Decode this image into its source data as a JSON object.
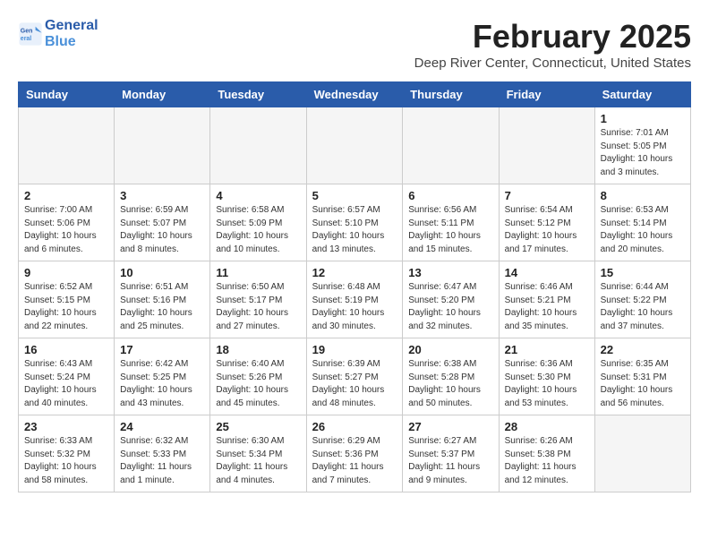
{
  "header": {
    "logo_line1": "General",
    "logo_line2": "Blue",
    "month_year": "February 2025",
    "location": "Deep River Center, Connecticut, United States"
  },
  "weekdays": [
    "Sunday",
    "Monday",
    "Tuesday",
    "Wednesday",
    "Thursday",
    "Friday",
    "Saturday"
  ],
  "weeks": [
    [
      {
        "day": "",
        "info": ""
      },
      {
        "day": "",
        "info": ""
      },
      {
        "day": "",
        "info": ""
      },
      {
        "day": "",
        "info": ""
      },
      {
        "day": "",
        "info": ""
      },
      {
        "day": "",
        "info": ""
      },
      {
        "day": "1",
        "info": "Sunrise: 7:01 AM\nSunset: 5:05 PM\nDaylight: 10 hours and 3 minutes."
      }
    ],
    [
      {
        "day": "2",
        "info": "Sunrise: 7:00 AM\nSunset: 5:06 PM\nDaylight: 10 hours and 6 minutes."
      },
      {
        "day": "3",
        "info": "Sunrise: 6:59 AM\nSunset: 5:07 PM\nDaylight: 10 hours and 8 minutes."
      },
      {
        "day": "4",
        "info": "Sunrise: 6:58 AM\nSunset: 5:09 PM\nDaylight: 10 hours and 10 minutes."
      },
      {
        "day": "5",
        "info": "Sunrise: 6:57 AM\nSunset: 5:10 PM\nDaylight: 10 hours and 13 minutes."
      },
      {
        "day": "6",
        "info": "Sunrise: 6:56 AM\nSunset: 5:11 PM\nDaylight: 10 hours and 15 minutes."
      },
      {
        "day": "7",
        "info": "Sunrise: 6:54 AM\nSunset: 5:12 PM\nDaylight: 10 hours and 17 minutes."
      },
      {
        "day": "8",
        "info": "Sunrise: 6:53 AM\nSunset: 5:14 PM\nDaylight: 10 hours and 20 minutes."
      }
    ],
    [
      {
        "day": "9",
        "info": "Sunrise: 6:52 AM\nSunset: 5:15 PM\nDaylight: 10 hours and 22 minutes."
      },
      {
        "day": "10",
        "info": "Sunrise: 6:51 AM\nSunset: 5:16 PM\nDaylight: 10 hours and 25 minutes."
      },
      {
        "day": "11",
        "info": "Sunrise: 6:50 AM\nSunset: 5:17 PM\nDaylight: 10 hours and 27 minutes."
      },
      {
        "day": "12",
        "info": "Sunrise: 6:48 AM\nSunset: 5:19 PM\nDaylight: 10 hours and 30 minutes."
      },
      {
        "day": "13",
        "info": "Sunrise: 6:47 AM\nSunset: 5:20 PM\nDaylight: 10 hours and 32 minutes."
      },
      {
        "day": "14",
        "info": "Sunrise: 6:46 AM\nSunset: 5:21 PM\nDaylight: 10 hours and 35 minutes."
      },
      {
        "day": "15",
        "info": "Sunrise: 6:44 AM\nSunset: 5:22 PM\nDaylight: 10 hours and 37 minutes."
      }
    ],
    [
      {
        "day": "16",
        "info": "Sunrise: 6:43 AM\nSunset: 5:24 PM\nDaylight: 10 hours and 40 minutes."
      },
      {
        "day": "17",
        "info": "Sunrise: 6:42 AM\nSunset: 5:25 PM\nDaylight: 10 hours and 43 minutes."
      },
      {
        "day": "18",
        "info": "Sunrise: 6:40 AM\nSunset: 5:26 PM\nDaylight: 10 hours and 45 minutes."
      },
      {
        "day": "19",
        "info": "Sunrise: 6:39 AM\nSunset: 5:27 PM\nDaylight: 10 hours and 48 minutes."
      },
      {
        "day": "20",
        "info": "Sunrise: 6:38 AM\nSunset: 5:28 PM\nDaylight: 10 hours and 50 minutes."
      },
      {
        "day": "21",
        "info": "Sunrise: 6:36 AM\nSunset: 5:30 PM\nDaylight: 10 hours and 53 minutes."
      },
      {
        "day": "22",
        "info": "Sunrise: 6:35 AM\nSunset: 5:31 PM\nDaylight: 10 hours and 56 minutes."
      }
    ],
    [
      {
        "day": "23",
        "info": "Sunrise: 6:33 AM\nSunset: 5:32 PM\nDaylight: 10 hours and 58 minutes."
      },
      {
        "day": "24",
        "info": "Sunrise: 6:32 AM\nSunset: 5:33 PM\nDaylight: 11 hours and 1 minute."
      },
      {
        "day": "25",
        "info": "Sunrise: 6:30 AM\nSunset: 5:34 PM\nDaylight: 11 hours and 4 minutes."
      },
      {
        "day": "26",
        "info": "Sunrise: 6:29 AM\nSunset: 5:36 PM\nDaylight: 11 hours and 7 minutes."
      },
      {
        "day": "27",
        "info": "Sunrise: 6:27 AM\nSunset: 5:37 PM\nDaylight: 11 hours and 9 minutes."
      },
      {
        "day": "28",
        "info": "Sunrise: 6:26 AM\nSunset: 5:38 PM\nDaylight: 11 hours and 12 minutes."
      },
      {
        "day": "",
        "info": ""
      }
    ]
  ]
}
